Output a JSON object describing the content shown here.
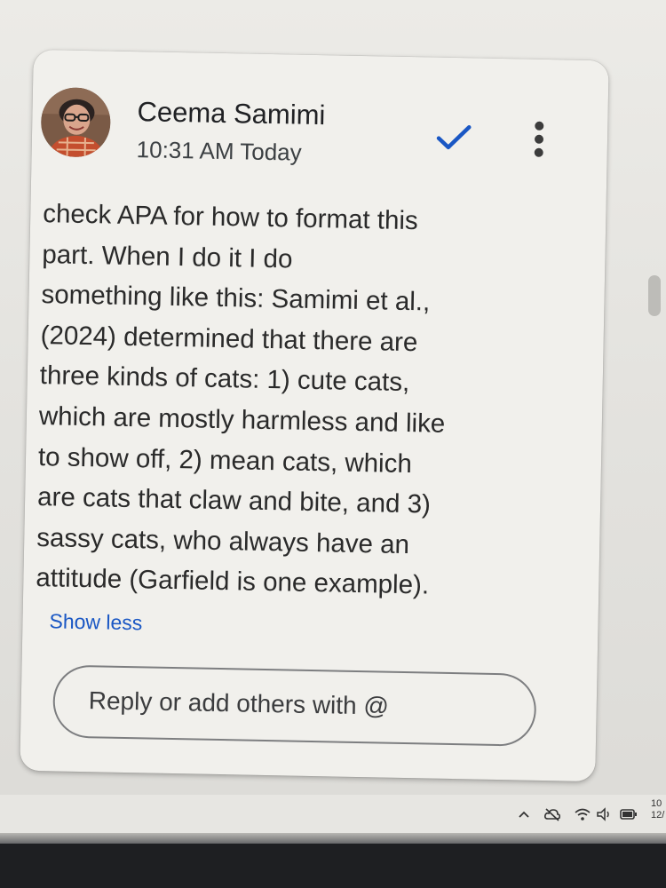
{
  "comment": {
    "author": "Ceema Samimi",
    "timestamp": "10:31 AM Today",
    "resolve_icon": "checkmark-icon",
    "more_icon": "more-vert-icon",
    "body_lines": [
      "check APA for how to format this",
      "part. When I do it I do",
      "something like this: Samimi et al.,",
      "(2024) determined that there are",
      "three kinds of cats: 1) cute cats,",
      "which are mostly harmless and like",
      "to show off, 2) mean cats, which",
      "are cats that claw and bite, and 3)",
      "sassy cats, who always have an",
      "attitude (Garfield is one example)."
    ],
    "show_less_label": "Show less",
    "reply_placeholder": "Reply or add others with @"
  },
  "taskbar": {
    "icons": [
      "chevron-up-icon",
      "cloud-off-icon",
      "wifi-icon",
      "speaker-icon",
      "battery-icon"
    ],
    "clock_line1": "10",
    "clock_line2": "12/"
  },
  "colors": {
    "accent": "#1a57c4",
    "card_background": "#f1f0ec",
    "text": "#202124"
  }
}
